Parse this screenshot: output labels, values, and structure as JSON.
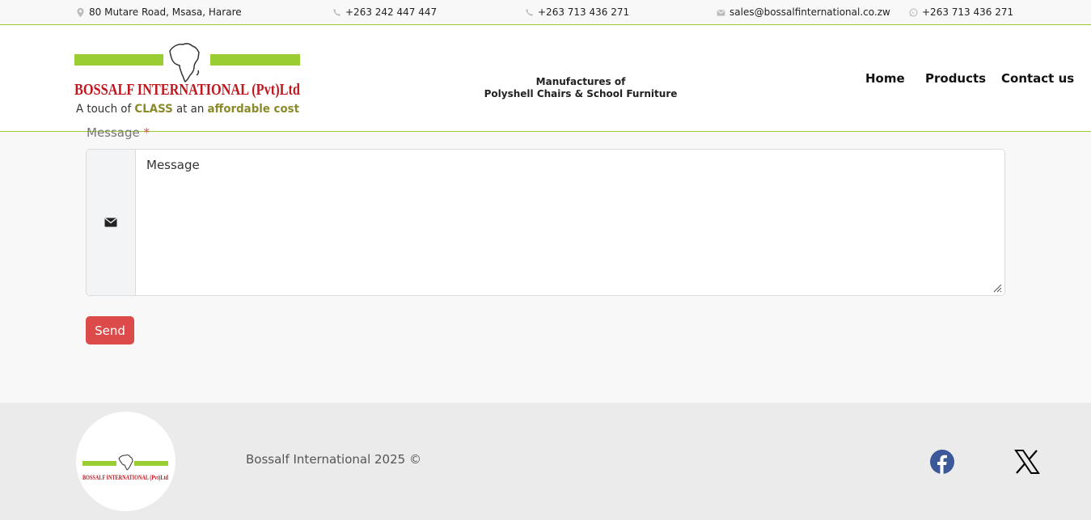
{
  "topbar": {
    "address": "80 Mutare Road, Msasa, Harare",
    "phone1": "+263 242 447 447",
    "phone2": "+263 713 436 271",
    "email": "sales@bossalfinternational.co.zw",
    "whatsapp": "+263 713 436 271",
    "icon_color": "#bbbbbb"
  },
  "header": {
    "logo_name": "BOSSALF INTERNATIONAL (Pvt)Ltd",
    "logo_slogan_pre": "A touch of ",
    "logo_slogan_class": "CLASS",
    "logo_slogan_mid": " at an ",
    "logo_slogan_post": "affordable cost",
    "tagline_line1": "Manufactures of",
    "tagline_line2": "Polyshell Chairs & School Furniture",
    "brand_green": "#9acd32",
    "brand_red": "#c0171f"
  },
  "nav": {
    "home": "Home",
    "products": "Products",
    "contact": "Contact us"
  },
  "form": {
    "message_label": "Message",
    "required_mark": "*",
    "message_placeholder": "Message",
    "send_label": "Send",
    "send_color": "#dc4a4a",
    "addon_icon": "envelope-icon"
  },
  "footer": {
    "copyright": "Bossalf International 2025 ©",
    "social": [
      "facebook-icon",
      "x-icon"
    ]
  }
}
